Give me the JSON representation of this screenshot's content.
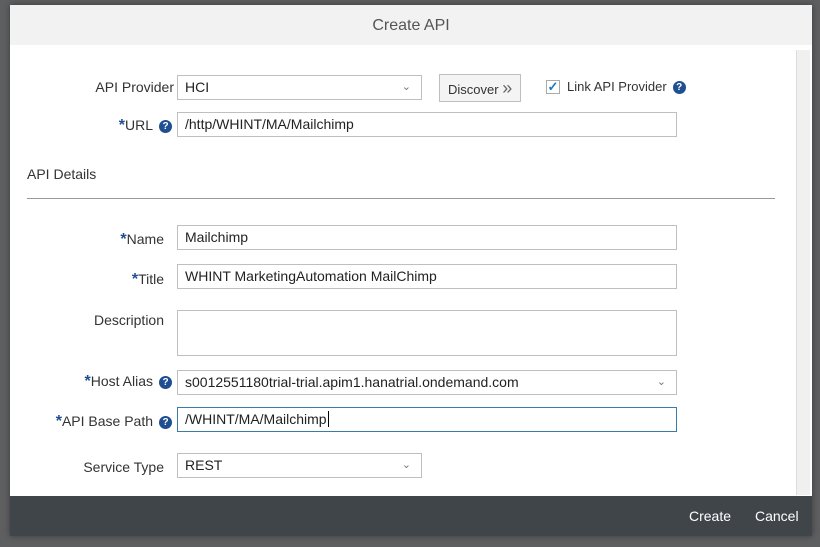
{
  "dialog": {
    "title": "Create API"
  },
  "form": {
    "api_provider": {
      "label": "API Provider",
      "value": "HCI"
    },
    "discover_label": "Discover",
    "link_provider": {
      "label": "Link API Provider",
      "checked": true
    },
    "url": {
      "label": "URL",
      "value": "/http/WHINT/MA/Mailchimp"
    },
    "section_title": "API Details",
    "name": {
      "label": "Name",
      "value": "Mailchimp"
    },
    "title": {
      "label": "Title",
      "value": "WHINT MarketingAutomation MailChimp"
    },
    "description": {
      "label": "Description",
      "value": ""
    },
    "host_alias": {
      "label": "Host Alias",
      "value": "s0012551180trial-trial.apim1.hanatrial.ondemand.com"
    },
    "base_path": {
      "label": "API Base Path",
      "value": "/WHINT/MA/Mailchimp"
    },
    "service_type": {
      "label": "Service Type",
      "value": "REST"
    }
  },
  "footer": {
    "create": "Create",
    "cancel": "Cancel"
  },
  "required_mark": "*",
  "help_glyph": "?"
}
